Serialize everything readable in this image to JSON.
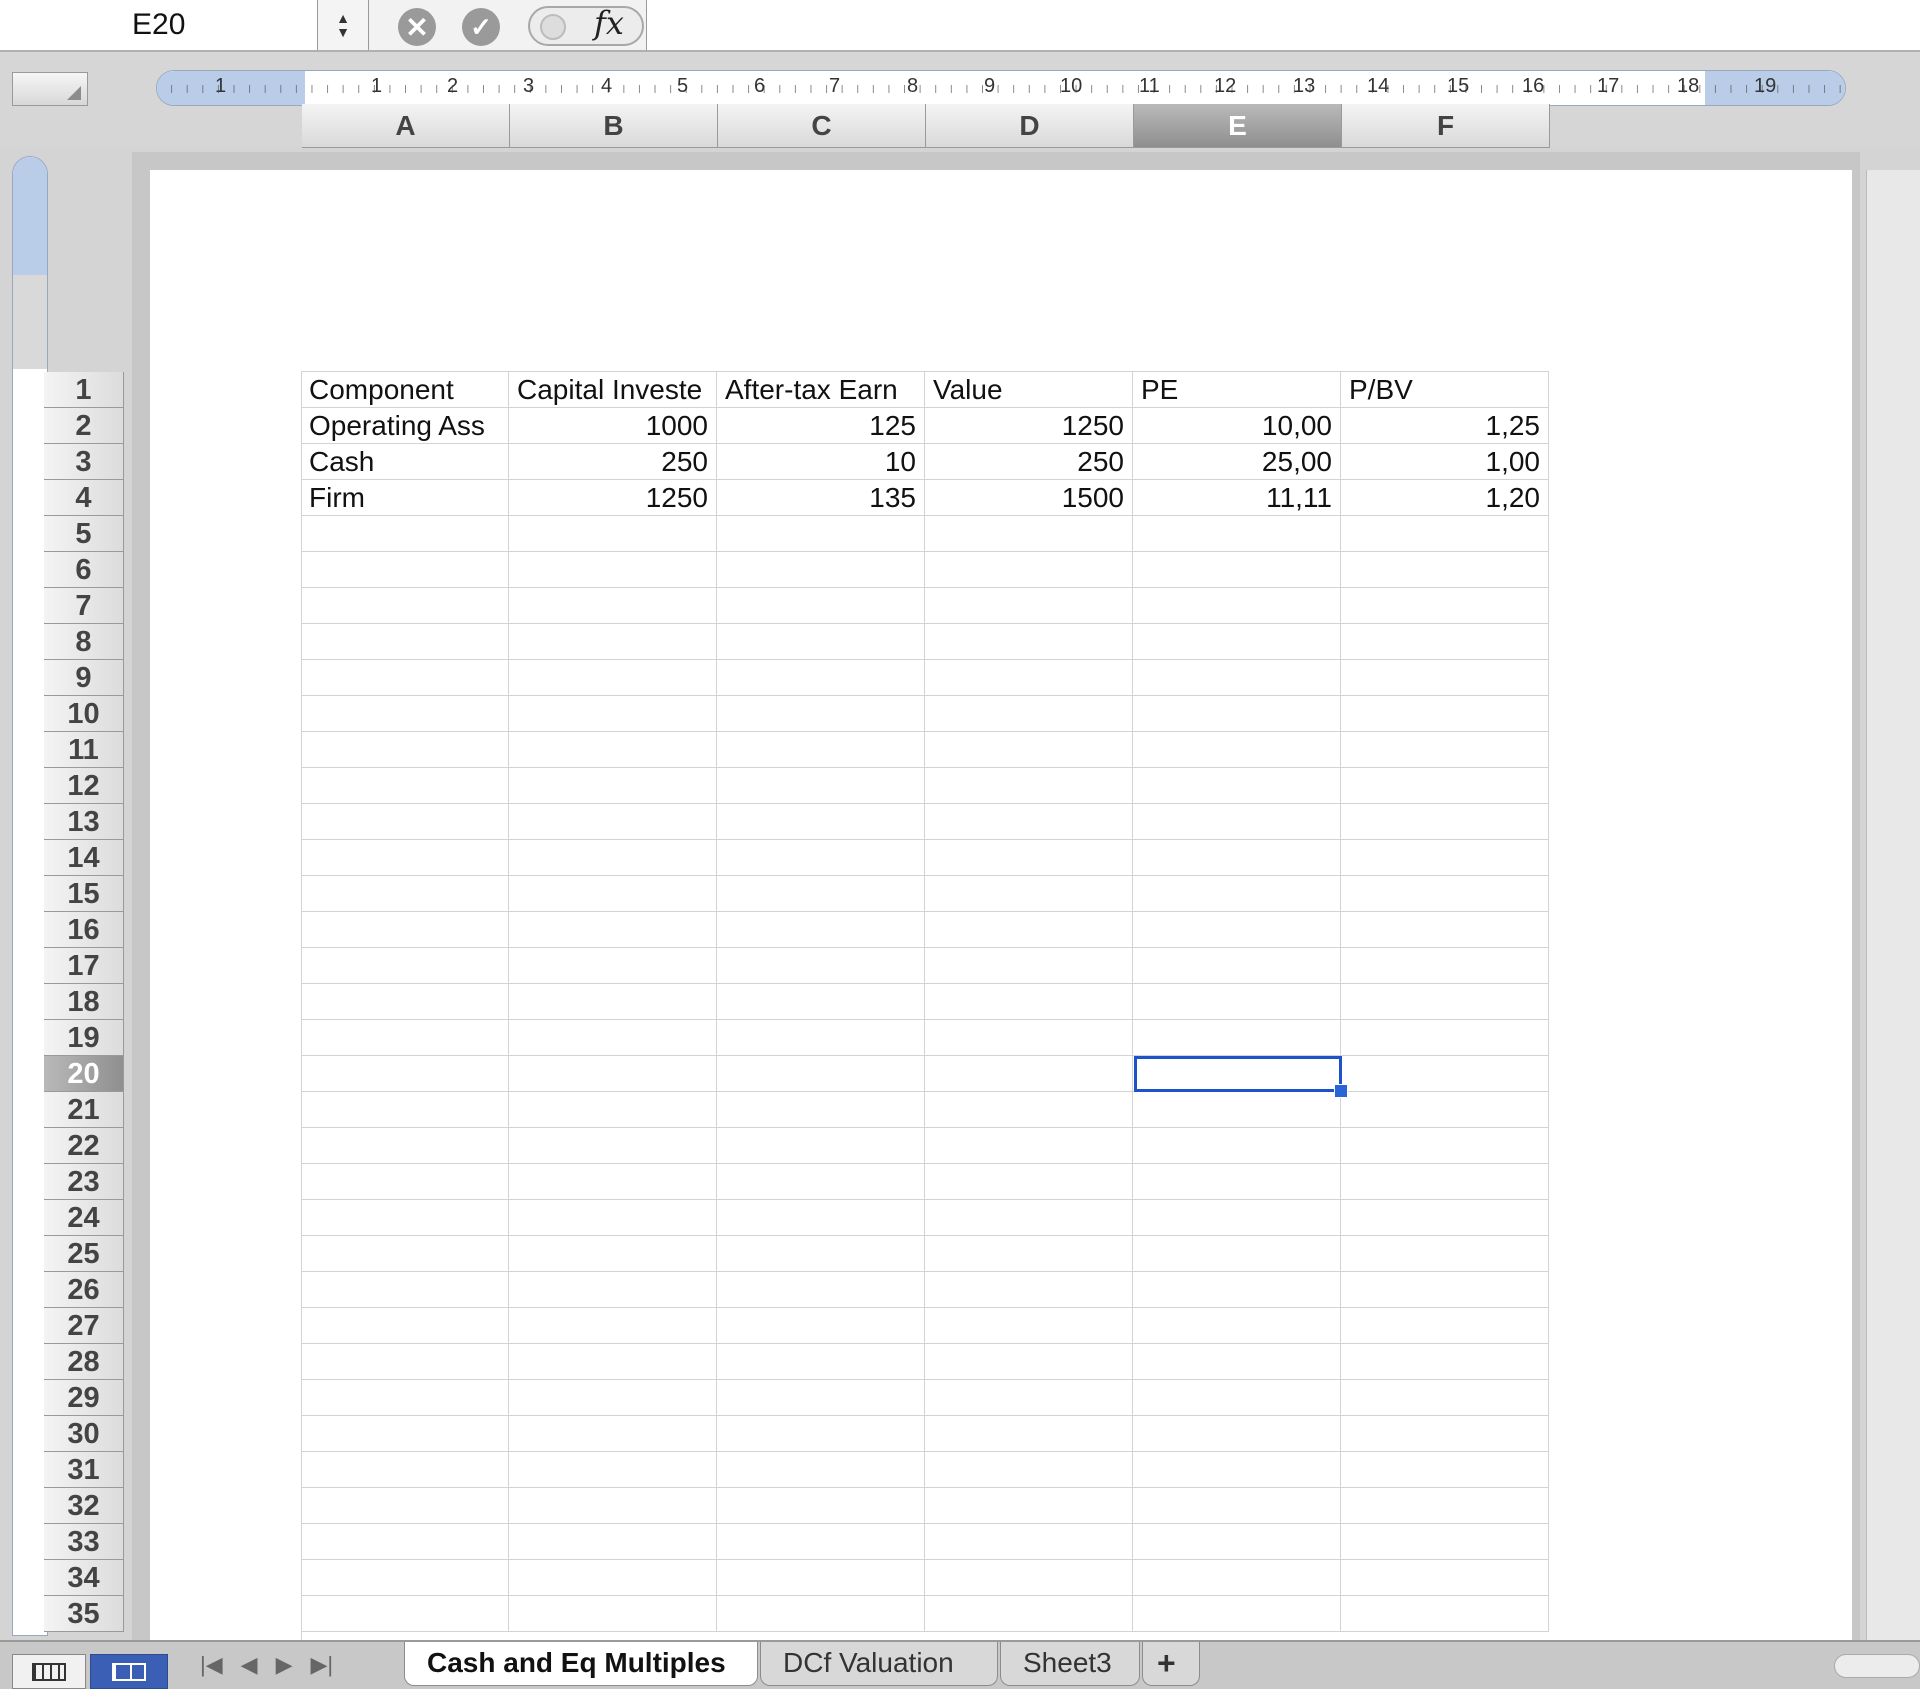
{
  "formula_bar": {
    "cell_reference": "E20",
    "stepper_up": "▲",
    "stepper_down": "▼",
    "cancel_glyph": "✕",
    "enter_glyph": "✓",
    "fx_label": "fx",
    "formula_value": ""
  },
  "ruler": {
    "labels": [
      "1",
      "1",
      "2",
      "3",
      "4",
      "5",
      "6",
      "7",
      "8",
      "9",
      "10",
      "11",
      "12",
      "13",
      "14",
      "15",
      "16",
      "17",
      "18",
      "19"
    ]
  },
  "columns": [
    "A",
    "B",
    "C",
    "D",
    "E",
    "F"
  ],
  "selected_column": "E",
  "rows": [
    "1",
    "2",
    "3",
    "4",
    "5",
    "6",
    "7",
    "8",
    "9",
    "10",
    "11",
    "12",
    "13",
    "14",
    "15",
    "16",
    "17",
    "18",
    "19",
    "20",
    "21",
    "22",
    "23",
    "24",
    "25",
    "26",
    "27",
    "28",
    "29",
    "30",
    "31",
    "32",
    "33",
    "34",
    "35"
  ],
  "selected_row": "20",
  "table": {
    "header": [
      "Component",
      "Capital Investe",
      "After-tax Earn",
      "Value",
      "PE",
      "P/BV"
    ],
    "rows": [
      [
        "Operating Ass",
        "1000",
        "125",
        "1250",
        "10,00",
        "1,25"
      ],
      [
        "Cash",
        "250",
        "10",
        "250",
        "25,00",
        "1,00"
      ],
      [
        "Firm",
        "1250",
        "135",
        "1500",
        "11,11",
        "1,20"
      ]
    ]
  },
  "sheet_tabs": [
    {
      "label": "Cash and Eq Multiples",
      "active": true
    },
    {
      "label": "DCf Valuation",
      "active": false
    },
    {
      "label": "Sheet3",
      "active": false
    }
  ],
  "add_sheet_label": "+",
  "nav_arrows": [
    "|◀",
    "◀",
    "▶",
    "▶|"
  ],
  "icons": {
    "cancel": "cancel-icon",
    "enter": "checkmark-icon",
    "function": "function-icon",
    "normal_view": "normal-view-icon",
    "page_layout_view": "page-layout-view-icon"
  },
  "colors": {
    "selection": "#1d52c8",
    "page_layout_active": "#3a5fb4",
    "ruler_margin": "#b9cde8"
  }
}
